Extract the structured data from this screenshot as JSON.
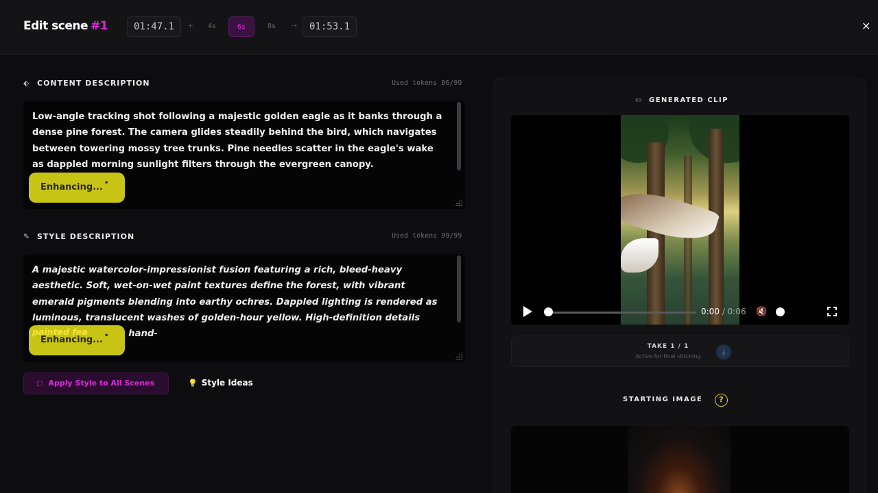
{
  "header": {
    "title": "Edit scene",
    "scene_number": "#1",
    "start_time": "01:47.1",
    "plus": "+",
    "durations": [
      "4s",
      "6s",
      "8s"
    ],
    "active_duration": "6s",
    "arrow": "→",
    "end_time": "01:53.1",
    "close_label": "×"
  },
  "content": {
    "label": "CONTENT DESCRIPTION",
    "tokens": "Used tokens 86/99",
    "text": "Low-angle tracking shot following a majestic golden eagle as it banks through a dense pine forest. The camera glides steadily behind the bird, which navigates between towering mossy tree trunks. Pine needles scatter in the eagle's wake as dappled morning sunlight filters through the evergreen canopy.",
    "enhancing_label": "Enhancing...",
    "icon": "tag-icon"
  },
  "style": {
    "label": "STYLE DESCRIPTION",
    "tokens": "Used tokens 99/99",
    "text": "A majestic watercolor-impressionist fusion featuring a rich, bleed-heavy aesthetic. Soft, wet-on-wet paint textures define the forest, with vibrant emerald pigments blending into earthy ochres. Dappled lighting is rendered as luminous, translucent washes of golden-hour yellow. High-definition details focus on intricate, hand-",
    "overflow_text": "painted fea",
    "enhancing_label": "Enhancing...",
    "icon": "brush-icon"
  },
  "actions": {
    "apply_style": "Apply Style to All Scenes",
    "style_ideas": "Style Ideas"
  },
  "clip": {
    "label": "GENERATED CLIP",
    "current_time": "0:00",
    "total_time": "/ 0:06",
    "progress": 0,
    "take_label": "TAKE 1 / 1",
    "take_sub": "Active for final stitching"
  },
  "starting_image": {
    "label": "STARTING IMAGE",
    "help": "?"
  },
  "colors": {
    "accent_magenta": "#d62ad6",
    "enhance_yellow": "#c8c416",
    "background": "#0d0d0f"
  }
}
